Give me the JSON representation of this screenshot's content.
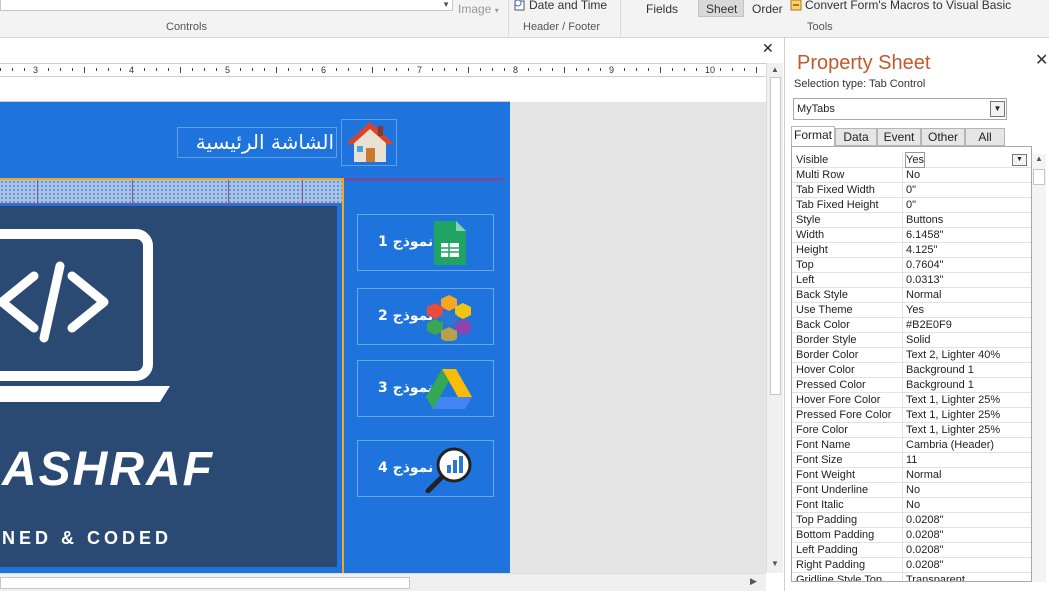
{
  "ribbon": {
    "image_label": "Image",
    "controls_group": "Controls",
    "date_time": "Date and Time",
    "header_footer_group": "Header / Footer",
    "fields": "Fields",
    "sheet": "Sheet",
    "order": "Order",
    "convert_macros": "Convert Form's Macros to Visual Basic",
    "tools_group": "Tools"
  },
  "ruler": {
    "numbers": [
      "3",
      "4",
      "5",
      "6",
      "7",
      "8",
      "9",
      "10"
    ]
  },
  "form": {
    "title": "الشاشة الرئيسية",
    "brand": "ASHRAF",
    "tagline": "NED & CODED",
    "nav_buttons": [
      {
        "label": "نموذج 1",
        "icon": "sheets-icon"
      },
      {
        "label": "نموذج 2",
        "icon": "hexagon-grid-icon"
      },
      {
        "label": "نموذج 3",
        "icon": "drive-icon"
      },
      {
        "label": "نموذج 4",
        "icon": "magnifier-chart-icon"
      }
    ]
  },
  "property_sheet": {
    "title": "Property Sheet",
    "selection_type": "Selection type:  Tab Control",
    "object": "MyTabs",
    "tabs": [
      "Format",
      "Data",
      "Event",
      "Other",
      "All"
    ],
    "active_tab": "Format",
    "rows": [
      {
        "k": "Visible",
        "v": "Yes"
      },
      {
        "k": "Multi Row",
        "v": "No"
      },
      {
        "k": "Tab Fixed Width",
        "v": "0\""
      },
      {
        "k": "Tab Fixed Height",
        "v": "0\""
      },
      {
        "k": "Style",
        "v": "Buttons"
      },
      {
        "k": "Width",
        "v": "6.1458\""
      },
      {
        "k": "Height",
        "v": "4.125\""
      },
      {
        "k": "Top",
        "v": "0.7604\""
      },
      {
        "k": "Left",
        "v": "0.0313\""
      },
      {
        "k": "Back Style",
        "v": "Normal"
      },
      {
        "k": "Use Theme",
        "v": "Yes"
      },
      {
        "k": "Back Color",
        "v": "#B2E0F9"
      },
      {
        "k": "Border Style",
        "v": "Solid"
      },
      {
        "k": "Border Color",
        "v": "Text 2, Lighter 40%"
      },
      {
        "k": "Hover Color",
        "v": "Background 1"
      },
      {
        "k": "Pressed Color",
        "v": "Background 1"
      },
      {
        "k": "Hover Fore Color",
        "v": "Text 1, Lighter 25%"
      },
      {
        "k": "Pressed Fore Color",
        "v": "Text 1, Lighter 25%"
      },
      {
        "k": "Fore Color",
        "v": "Text 1, Lighter 25%"
      },
      {
        "k": "Font Name",
        "v": "Cambria (Header)"
      },
      {
        "k": "Font Size",
        "v": "11"
      },
      {
        "k": "Font Weight",
        "v": "Normal"
      },
      {
        "k": "Font Underline",
        "v": "No"
      },
      {
        "k": "Font Italic",
        "v": "No"
      },
      {
        "k": "Top Padding",
        "v": "0.0208\""
      },
      {
        "k": "Bottom Padding",
        "v": "0.0208\""
      },
      {
        "k": "Left Padding",
        "v": "0.0208\""
      },
      {
        "k": "Right Padding",
        "v": "0.0208\""
      },
      {
        "k": "Gridline Style Top",
        "v": "Transparent"
      }
    ]
  },
  "colors": {
    "form_back": "#1E73DC",
    "title_orange": "#C05A2C",
    "selection_orange": "#F5A623"
  }
}
